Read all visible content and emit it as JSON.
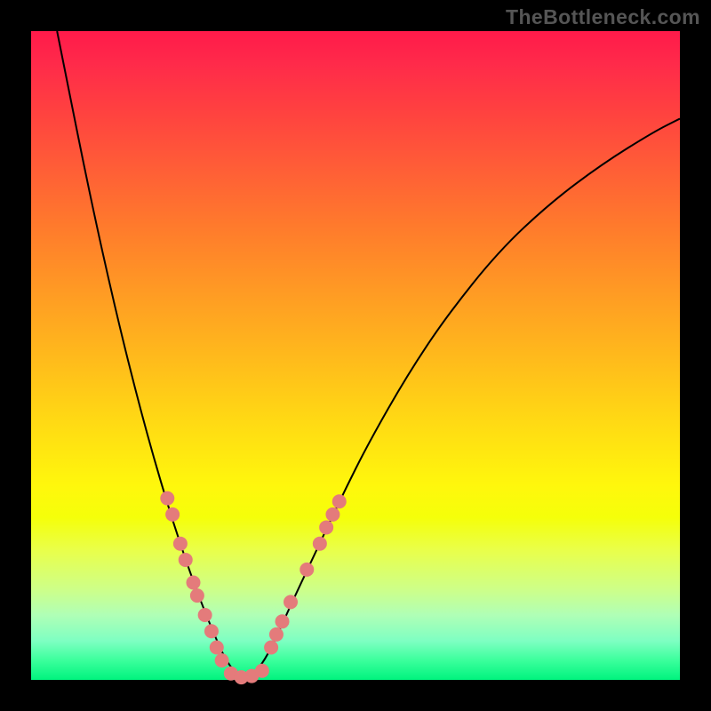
{
  "watermark": "TheBottleneck.com",
  "chart_data": {
    "type": "line",
    "title": "",
    "xlabel": "",
    "ylabel": "",
    "xlim": [
      0,
      100
    ],
    "ylim": [
      0,
      100
    ],
    "grid": false,
    "legend": false,
    "description": "V-shaped bottleneck curve on red-yellow-green vertical gradient background. Minimum of curve sits near x≈30, y≈0. Salmon-colored dot markers cluster along both arms of the V near the bottom.",
    "series": [
      {
        "name": "curve",
        "stroke": "#000000",
        "stroke_width": 2,
        "x": [
          4,
          6,
          8,
          10,
          12,
          14,
          16,
          18,
          20,
          22,
          24,
          26,
          28,
          30,
          32,
          34,
          36,
          38,
          40,
          44,
          48,
          52,
          58,
          64,
          72,
          80,
          88,
          96,
          100
        ],
        "y": [
          100,
          90,
          80,
          70.5,
          61.5,
          53,
          45,
          37.5,
          30.5,
          24,
          18,
          12.5,
          7.5,
          3,
          0.5,
          0.5,
          3,
          7,
          11.5,
          20,
          28.5,
          36.5,
          47,
          56,
          66,
          73.5,
          79.5,
          84.5,
          86.5
        ]
      }
    ],
    "markers": [
      {
        "name": "dots",
        "fill": "#e47b7b",
        "radius": 8,
        "points": [
          {
            "x": 21.0,
            "y": 28.0
          },
          {
            "x": 21.8,
            "y": 25.5
          },
          {
            "x": 23.0,
            "y": 21.0
          },
          {
            "x": 23.8,
            "y": 18.5
          },
          {
            "x": 25.0,
            "y": 15.0
          },
          {
            "x": 25.6,
            "y": 13.0
          },
          {
            "x": 26.8,
            "y": 10.0
          },
          {
            "x": 27.8,
            "y": 7.5
          },
          {
            "x": 28.6,
            "y": 5.0
          },
          {
            "x": 29.4,
            "y": 3.0
          },
          {
            "x": 30.8,
            "y": 1.0
          },
          {
            "x": 32.4,
            "y": 0.4
          },
          {
            "x": 34.0,
            "y": 0.6
          },
          {
            "x": 35.6,
            "y": 1.4
          },
          {
            "x": 37.0,
            "y": 5.0
          },
          {
            "x": 37.8,
            "y": 7.0
          },
          {
            "x": 38.7,
            "y": 9.0
          },
          {
            "x": 40.0,
            "y": 12.0
          },
          {
            "x": 42.5,
            "y": 17.0
          },
          {
            "x": 44.5,
            "y": 21.0
          },
          {
            "x": 45.5,
            "y": 23.5
          },
          {
            "x": 46.5,
            "y": 25.5
          },
          {
            "x": 47.5,
            "y": 27.5
          }
        ]
      }
    ],
    "background_gradient": {
      "direction": "vertical",
      "stops": [
        {
          "pos": 0.0,
          "color": "#ff1a4a"
        },
        {
          "pos": 0.5,
          "color": "#ffb91c"
        },
        {
          "pos": 0.75,
          "color": "#f5ff0a"
        },
        {
          "pos": 1.0,
          "color": "#00f37e"
        }
      ]
    }
  }
}
